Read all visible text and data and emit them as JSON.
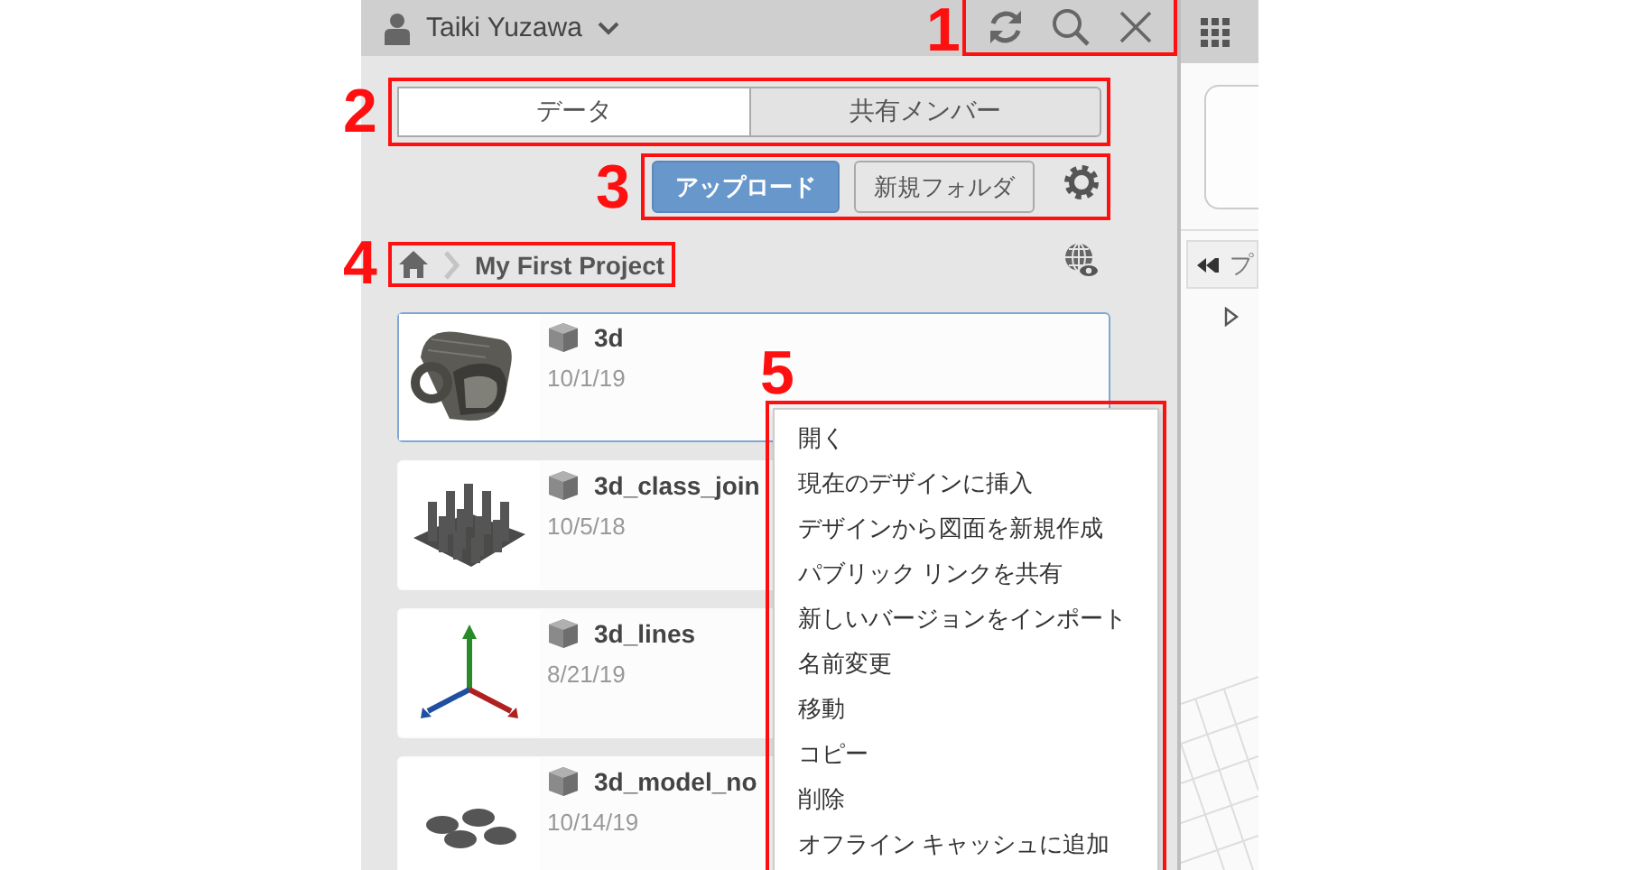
{
  "header": {
    "user_name": "Taiki Yuzawa"
  },
  "tabs": [
    {
      "label": "データ",
      "selected": true
    },
    {
      "label": "共有メンバー",
      "selected": false
    }
  ],
  "toolbar": {
    "upload_button": "アップロード",
    "new_folder_button": "新規フォルダ"
  },
  "breadcrumb": {
    "project": "My First Project"
  },
  "files": [
    {
      "name": "3d",
      "date": "10/1/19",
      "selected": true,
      "kind": "profile"
    },
    {
      "name": "3d_class_join",
      "date": "10/5/18",
      "selected": false,
      "kind": "grid"
    },
    {
      "name": "3d_lines",
      "date": "8/21/19",
      "selected": false,
      "kind": "axes"
    },
    {
      "name": "3d_model_no",
      "date": "10/14/19",
      "selected": false,
      "kind": "discs"
    }
  ],
  "context_menu": {
    "items": [
      "開く",
      "現在のデザインに挿入",
      "デザインから図面を新規作成",
      "パブリック リンクを共有",
      "新しいバージョンをインポート",
      "名前変更",
      "移動",
      "コピー",
      "削除",
      "オフライン キャッシュに追加"
    ]
  },
  "right_panel": {
    "tab_label": "プ"
  },
  "annotations": [
    "1",
    "2",
    "3",
    "4",
    "5"
  ]
}
